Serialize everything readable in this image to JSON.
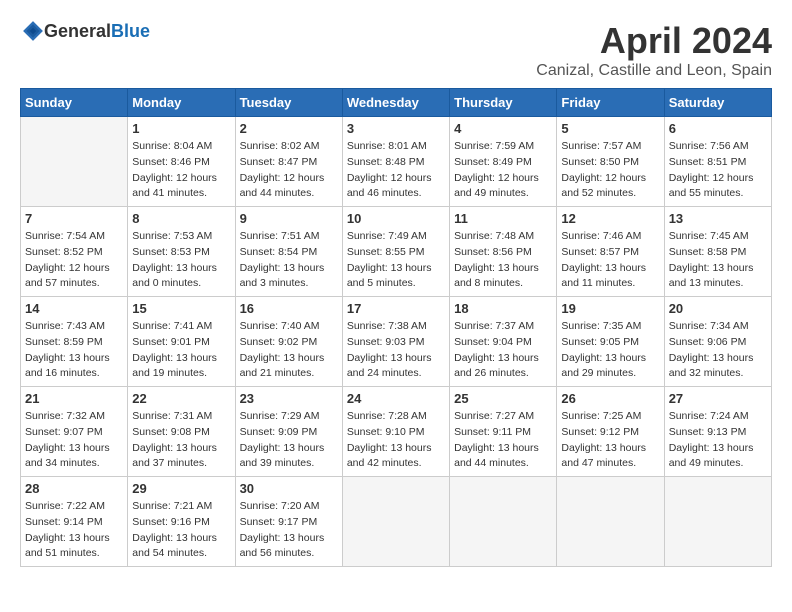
{
  "header": {
    "logo_general": "General",
    "logo_blue": "Blue",
    "month_title": "April 2024",
    "location": "Canizal, Castille and Leon, Spain"
  },
  "weekdays": [
    "Sunday",
    "Monday",
    "Tuesday",
    "Wednesday",
    "Thursday",
    "Friday",
    "Saturday"
  ],
  "weeks": [
    [
      {
        "day": "",
        "empty": true
      },
      {
        "day": "1",
        "sunrise": "Sunrise: 8:04 AM",
        "sunset": "Sunset: 8:46 PM",
        "daylight": "Daylight: 12 hours and 41 minutes."
      },
      {
        "day": "2",
        "sunrise": "Sunrise: 8:02 AM",
        "sunset": "Sunset: 8:47 PM",
        "daylight": "Daylight: 12 hours and 44 minutes."
      },
      {
        "day": "3",
        "sunrise": "Sunrise: 8:01 AM",
        "sunset": "Sunset: 8:48 PM",
        "daylight": "Daylight: 12 hours and 46 minutes."
      },
      {
        "day": "4",
        "sunrise": "Sunrise: 7:59 AM",
        "sunset": "Sunset: 8:49 PM",
        "daylight": "Daylight: 12 hours and 49 minutes."
      },
      {
        "day": "5",
        "sunrise": "Sunrise: 7:57 AM",
        "sunset": "Sunset: 8:50 PM",
        "daylight": "Daylight: 12 hours and 52 minutes."
      },
      {
        "day": "6",
        "sunrise": "Sunrise: 7:56 AM",
        "sunset": "Sunset: 8:51 PM",
        "daylight": "Daylight: 12 hours and 55 minutes."
      }
    ],
    [
      {
        "day": "7",
        "sunrise": "Sunrise: 7:54 AM",
        "sunset": "Sunset: 8:52 PM",
        "daylight": "Daylight: 12 hours and 57 minutes."
      },
      {
        "day": "8",
        "sunrise": "Sunrise: 7:53 AM",
        "sunset": "Sunset: 8:53 PM",
        "daylight": "Daylight: 13 hours and 0 minutes."
      },
      {
        "day": "9",
        "sunrise": "Sunrise: 7:51 AM",
        "sunset": "Sunset: 8:54 PM",
        "daylight": "Daylight: 13 hours and 3 minutes."
      },
      {
        "day": "10",
        "sunrise": "Sunrise: 7:49 AM",
        "sunset": "Sunset: 8:55 PM",
        "daylight": "Daylight: 13 hours and 5 minutes."
      },
      {
        "day": "11",
        "sunrise": "Sunrise: 7:48 AM",
        "sunset": "Sunset: 8:56 PM",
        "daylight": "Daylight: 13 hours and 8 minutes."
      },
      {
        "day": "12",
        "sunrise": "Sunrise: 7:46 AM",
        "sunset": "Sunset: 8:57 PM",
        "daylight": "Daylight: 13 hours and 11 minutes."
      },
      {
        "day": "13",
        "sunrise": "Sunrise: 7:45 AM",
        "sunset": "Sunset: 8:58 PM",
        "daylight": "Daylight: 13 hours and 13 minutes."
      }
    ],
    [
      {
        "day": "14",
        "sunrise": "Sunrise: 7:43 AM",
        "sunset": "Sunset: 8:59 PM",
        "daylight": "Daylight: 13 hours and 16 minutes."
      },
      {
        "day": "15",
        "sunrise": "Sunrise: 7:41 AM",
        "sunset": "Sunset: 9:01 PM",
        "daylight": "Daylight: 13 hours and 19 minutes."
      },
      {
        "day": "16",
        "sunrise": "Sunrise: 7:40 AM",
        "sunset": "Sunset: 9:02 PM",
        "daylight": "Daylight: 13 hours and 21 minutes."
      },
      {
        "day": "17",
        "sunrise": "Sunrise: 7:38 AM",
        "sunset": "Sunset: 9:03 PM",
        "daylight": "Daylight: 13 hours and 24 minutes."
      },
      {
        "day": "18",
        "sunrise": "Sunrise: 7:37 AM",
        "sunset": "Sunset: 9:04 PM",
        "daylight": "Daylight: 13 hours and 26 minutes."
      },
      {
        "day": "19",
        "sunrise": "Sunrise: 7:35 AM",
        "sunset": "Sunset: 9:05 PM",
        "daylight": "Daylight: 13 hours and 29 minutes."
      },
      {
        "day": "20",
        "sunrise": "Sunrise: 7:34 AM",
        "sunset": "Sunset: 9:06 PM",
        "daylight": "Daylight: 13 hours and 32 minutes."
      }
    ],
    [
      {
        "day": "21",
        "sunrise": "Sunrise: 7:32 AM",
        "sunset": "Sunset: 9:07 PM",
        "daylight": "Daylight: 13 hours and 34 minutes."
      },
      {
        "day": "22",
        "sunrise": "Sunrise: 7:31 AM",
        "sunset": "Sunset: 9:08 PM",
        "daylight": "Daylight: 13 hours and 37 minutes."
      },
      {
        "day": "23",
        "sunrise": "Sunrise: 7:29 AM",
        "sunset": "Sunset: 9:09 PM",
        "daylight": "Daylight: 13 hours and 39 minutes."
      },
      {
        "day": "24",
        "sunrise": "Sunrise: 7:28 AM",
        "sunset": "Sunset: 9:10 PM",
        "daylight": "Daylight: 13 hours and 42 minutes."
      },
      {
        "day": "25",
        "sunrise": "Sunrise: 7:27 AM",
        "sunset": "Sunset: 9:11 PM",
        "daylight": "Daylight: 13 hours and 44 minutes."
      },
      {
        "day": "26",
        "sunrise": "Sunrise: 7:25 AM",
        "sunset": "Sunset: 9:12 PM",
        "daylight": "Daylight: 13 hours and 47 minutes."
      },
      {
        "day": "27",
        "sunrise": "Sunrise: 7:24 AM",
        "sunset": "Sunset: 9:13 PM",
        "daylight": "Daylight: 13 hours and 49 minutes."
      }
    ],
    [
      {
        "day": "28",
        "sunrise": "Sunrise: 7:22 AM",
        "sunset": "Sunset: 9:14 PM",
        "daylight": "Daylight: 13 hours and 51 minutes."
      },
      {
        "day": "29",
        "sunrise": "Sunrise: 7:21 AM",
        "sunset": "Sunset: 9:16 PM",
        "daylight": "Daylight: 13 hours and 54 minutes."
      },
      {
        "day": "30",
        "sunrise": "Sunrise: 7:20 AM",
        "sunset": "Sunset: 9:17 PM",
        "daylight": "Daylight: 13 hours and 56 minutes."
      },
      {
        "day": "",
        "empty": true
      },
      {
        "day": "",
        "empty": true
      },
      {
        "day": "",
        "empty": true
      },
      {
        "day": "",
        "empty": true
      }
    ]
  ]
}
